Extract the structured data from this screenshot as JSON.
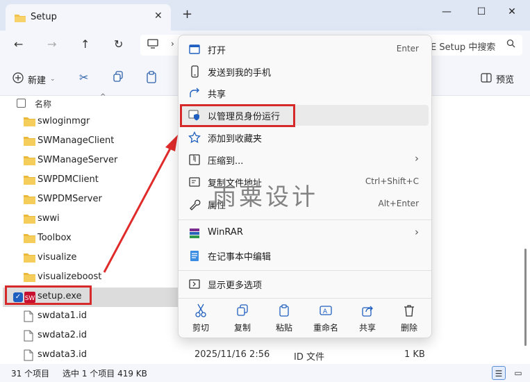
{
  "window": {
    "tab_title": "Setup",
    "new_tab": "+",
    "minimize": "—",
    "maximize": "☐",
    "close": "✕"
  },
  "navbar": {
    "search_placeholder": "E Setup 中搜索"
  },
  "toolbar": {
    "new_label": "新建",
    "preview_label": "预览"
  },
  "filelist": {
    "header_name": "名称",
    "items": [
      {
        "name": "swloginmgr",
        "type": "folder"
      },
      {
        "name": "SWManageClient",
        "type": "folder"
      },
      {
        "name": "SWManageServer",
        "type": "folder"
      },
      {
        "name": "SWPDMClient",
        "type": "folder"
      },
      {
        "name": "SWPDMServer",
        "type": "folder"
      },
      {
        "name": "swwi",
        "type": "folder"
      },
      {
        "name": "Toolbox",
        "type": "folder"
      },
      {
        "name": "visualize",
        "type": "folder"
      },
      {
        "name": "visualizeboost",
        "type": "folder"
      },
      {
        "name": "setup.exe",
        "type": "exe"
      },
      {
        "name": "swdata1.id",
        "type": "file"
      },
      {
        "name": "swdata2.id",
        "type": "file"
      },
      {
        "name": "swdata3.id",
        "type": "file"
      }
    ],
    "last_row": {
      "date": "2025/11/16 2:56",
      "type": "ID 文件",
      "size": "1 KB"
    }
  },
  "status": {
    "count": "31 个项目",
    "selection": "选中 1 个项目  419 KB"
  },
  "menu": {
    "items": [
      {
        "label": "打开",
        "shortcut": "Enter"
      },
      {
        "label": "发送到我的手机",
        "shortcut": ""
      },
      {
        "label": "共享",
        "shortcut": ""
      },
      {
        "label": "以管理员身份运行",
        "shortcut": ""
      },
      {
        "label": "添加到收藏夹",
        "shortcut": ""
      },
      {
        "label": "压缩到...",
        "shortcut": ""
      },
      {
        "label": "复制文件地址",
        "shortcut": "Ctrl+Shift+C"
      },
      {
        "label": "属性",
        "shortcut": "Alt+Enter"
      },
      {
        "label": "WinRAR",
        "shortcut": ""
      },
      {
        "label": "在记事本中编辑",
        "shortcut": ""
      },
      {
        "label": "显示更多选项",
        "shortcut": ""
      }
    ],
    "actions": [
      "剪切",
      "复制",
      "粘贴",
      "重命名",
      "共享",
      "删除"
    ]
  },
  "watermark": "雨粟设计",
  "colors": {
    "accent": "#1f5fbf",
    "highlight_red": "#d62a2a",
    "folder": "#f2c14e"
  }
}
